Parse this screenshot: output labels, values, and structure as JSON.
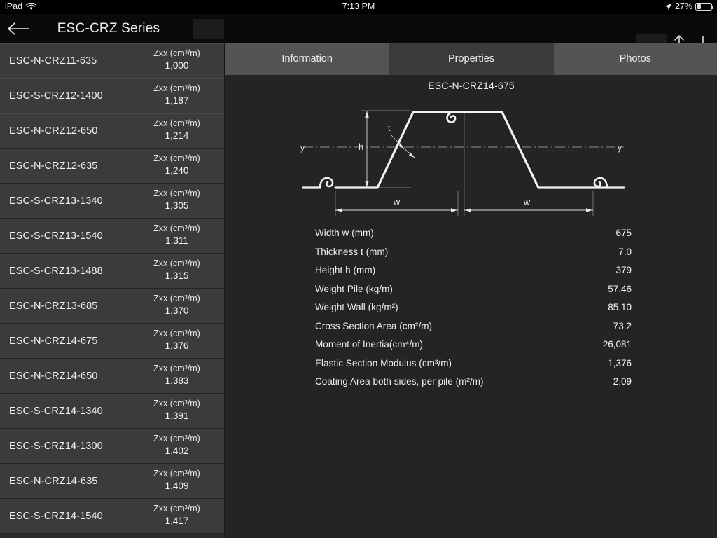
{
  "statusbar": {
    "device": "iPad",
    "wifi_icon": "wifi-icon",
    "time": "7:13 PM",
    "location_icon": "location-arrow-icon",
    "battery_percent": "27%",
    "battery_icon": "battery-icon"
  },
  "navbar": {
    "back_icon": "back-arrow-icon",
    "title": "ESC-CRZ Series",
    "up_icon": "arrow-up-icon",
    "down_icon": "arrow-down-icon"
  },
  "sidebar": {
    "unit_label": "Zxx (cm³/m)",
    "items": [
      {
        "name": "ESC-N-CRZ11-635",
        "unit": "Zxx (cm³/m)",
        "value": "1,000"
      },
      {
        "name": "ESC-S-CRZ12-1400",
        "unit": "Zxx (cm³/m)",
        "value": "1,187"
      },
      {
        "name": "ESC-N-CRZ12-650",
        "unit": "Zxx (cm³/m)",
        "value": "1,214"
      },
      {
        "name": "ESC-N-CRZ12-635",
        "unit": "Zxx (cm³/m)",
        "value": "1,240"
      },
      {
        "name": "ESC-S-CRZ13-1340",
        "unit": "Zxx (cm³/m)",
        "value": "1,305"
      },
      {
        "name": "ESC-S-CRZ13-1540",
        "unit": "Zxx (cm³/m)",
        "value": "1,311"
      },
      {
        "name": "ESC-S-CRZ13-1488",
        "unit": "Zxx (cm³/m)",
        "value": "1,315"
      },
      {
        "name": "ESC-N-CRZ13-685",
        "unit": "Zxx (cm³/m)",
        "value": "1,370"
      },
      {
        "name": "ESC-N-CRZ14-675",
        "unit": "Zxx (cm³/m)",
        "value": "1,376"
      },
      {
        "name": "ESC-N-CRZ14-650",
        "unit": "Zxx (cm³/m)",
        "value": "1,383"
      },
      {
        "name": "ESC-S-CRZ14-1340",
        "unit": "Zxx (cm³/m)",
        "value": "1,391"
      },
      {
        "name": "ESC-S-CRZ14-1300",
        "unit": "Zxx (cm³/m)",
        "value": "1,402"
      },
      {
        "name": "ESC-N-CRZ14-635",
        "unit": "Zxx (cm³/m)",
        "value": "1,409"
      },
      {
        "name": "ESC-S-CRZ14-1540",
        "unit": "Zxx (cm³/m)",
        "value": "1,417"
      }
    ]
  },
  "content": {
    "tabs": [
      {
        "label": "Information",
        "active": false
      },
      {
        "label": "Properties",
        "active": true
      },
      {
        "label": "Photos",
        "active": false
      }
    ],
    "title": "ESC-N-CRZ14-675",
    "diagram": {
      "name": "z-section-sheet-pile-profile",
      "labels": {
        "axis_left": "y",
        "axis_right": "y",
        "height": "h",
        "thickness": "t",
        "width_left": "w",
        "width_right": "w"
      }
    },
    "properties": [
      {
        "label": "Width w (mm)",
        "value": "675"
      },
      {
        "label": "Thickness t (mm)",
        "value": "7.0"
      },
      {
        "label": "Height h (mm)",
        "value": "379"
      },
      {
        "label": "Weight Pile (kg/m)",
        "value": "57.46"
      },
      {
        "label": "Weight Wall (kg/m²)",
        "value": "85.10"
      },
      {
        "label": "Cross Section Area (cm²/m)",
        "value": "73.2"
      },
      {
        "label": "Moment of Inertia(cm⁴/m)",
        "value": "26,081"
      },
      {
        "label": "Elastic Section Modulus (cm³/m)",
        "value": "1,376"
      },
      {
        "label": "Coating Area both sides, per pile (m²/m)",
        "value": "2.09"
      }
    ]
  },
  "colors": {
    "background": "#000000",
    "navbar": "#0a0a0a",
    "sidebar_row": "#3b3b3b",
    "content_bg": "#242424",
    "tab_inactive": "#545454",
    "tab_active": "#3b3b3b",
    "text": "#f2f2f2"
  }
}
